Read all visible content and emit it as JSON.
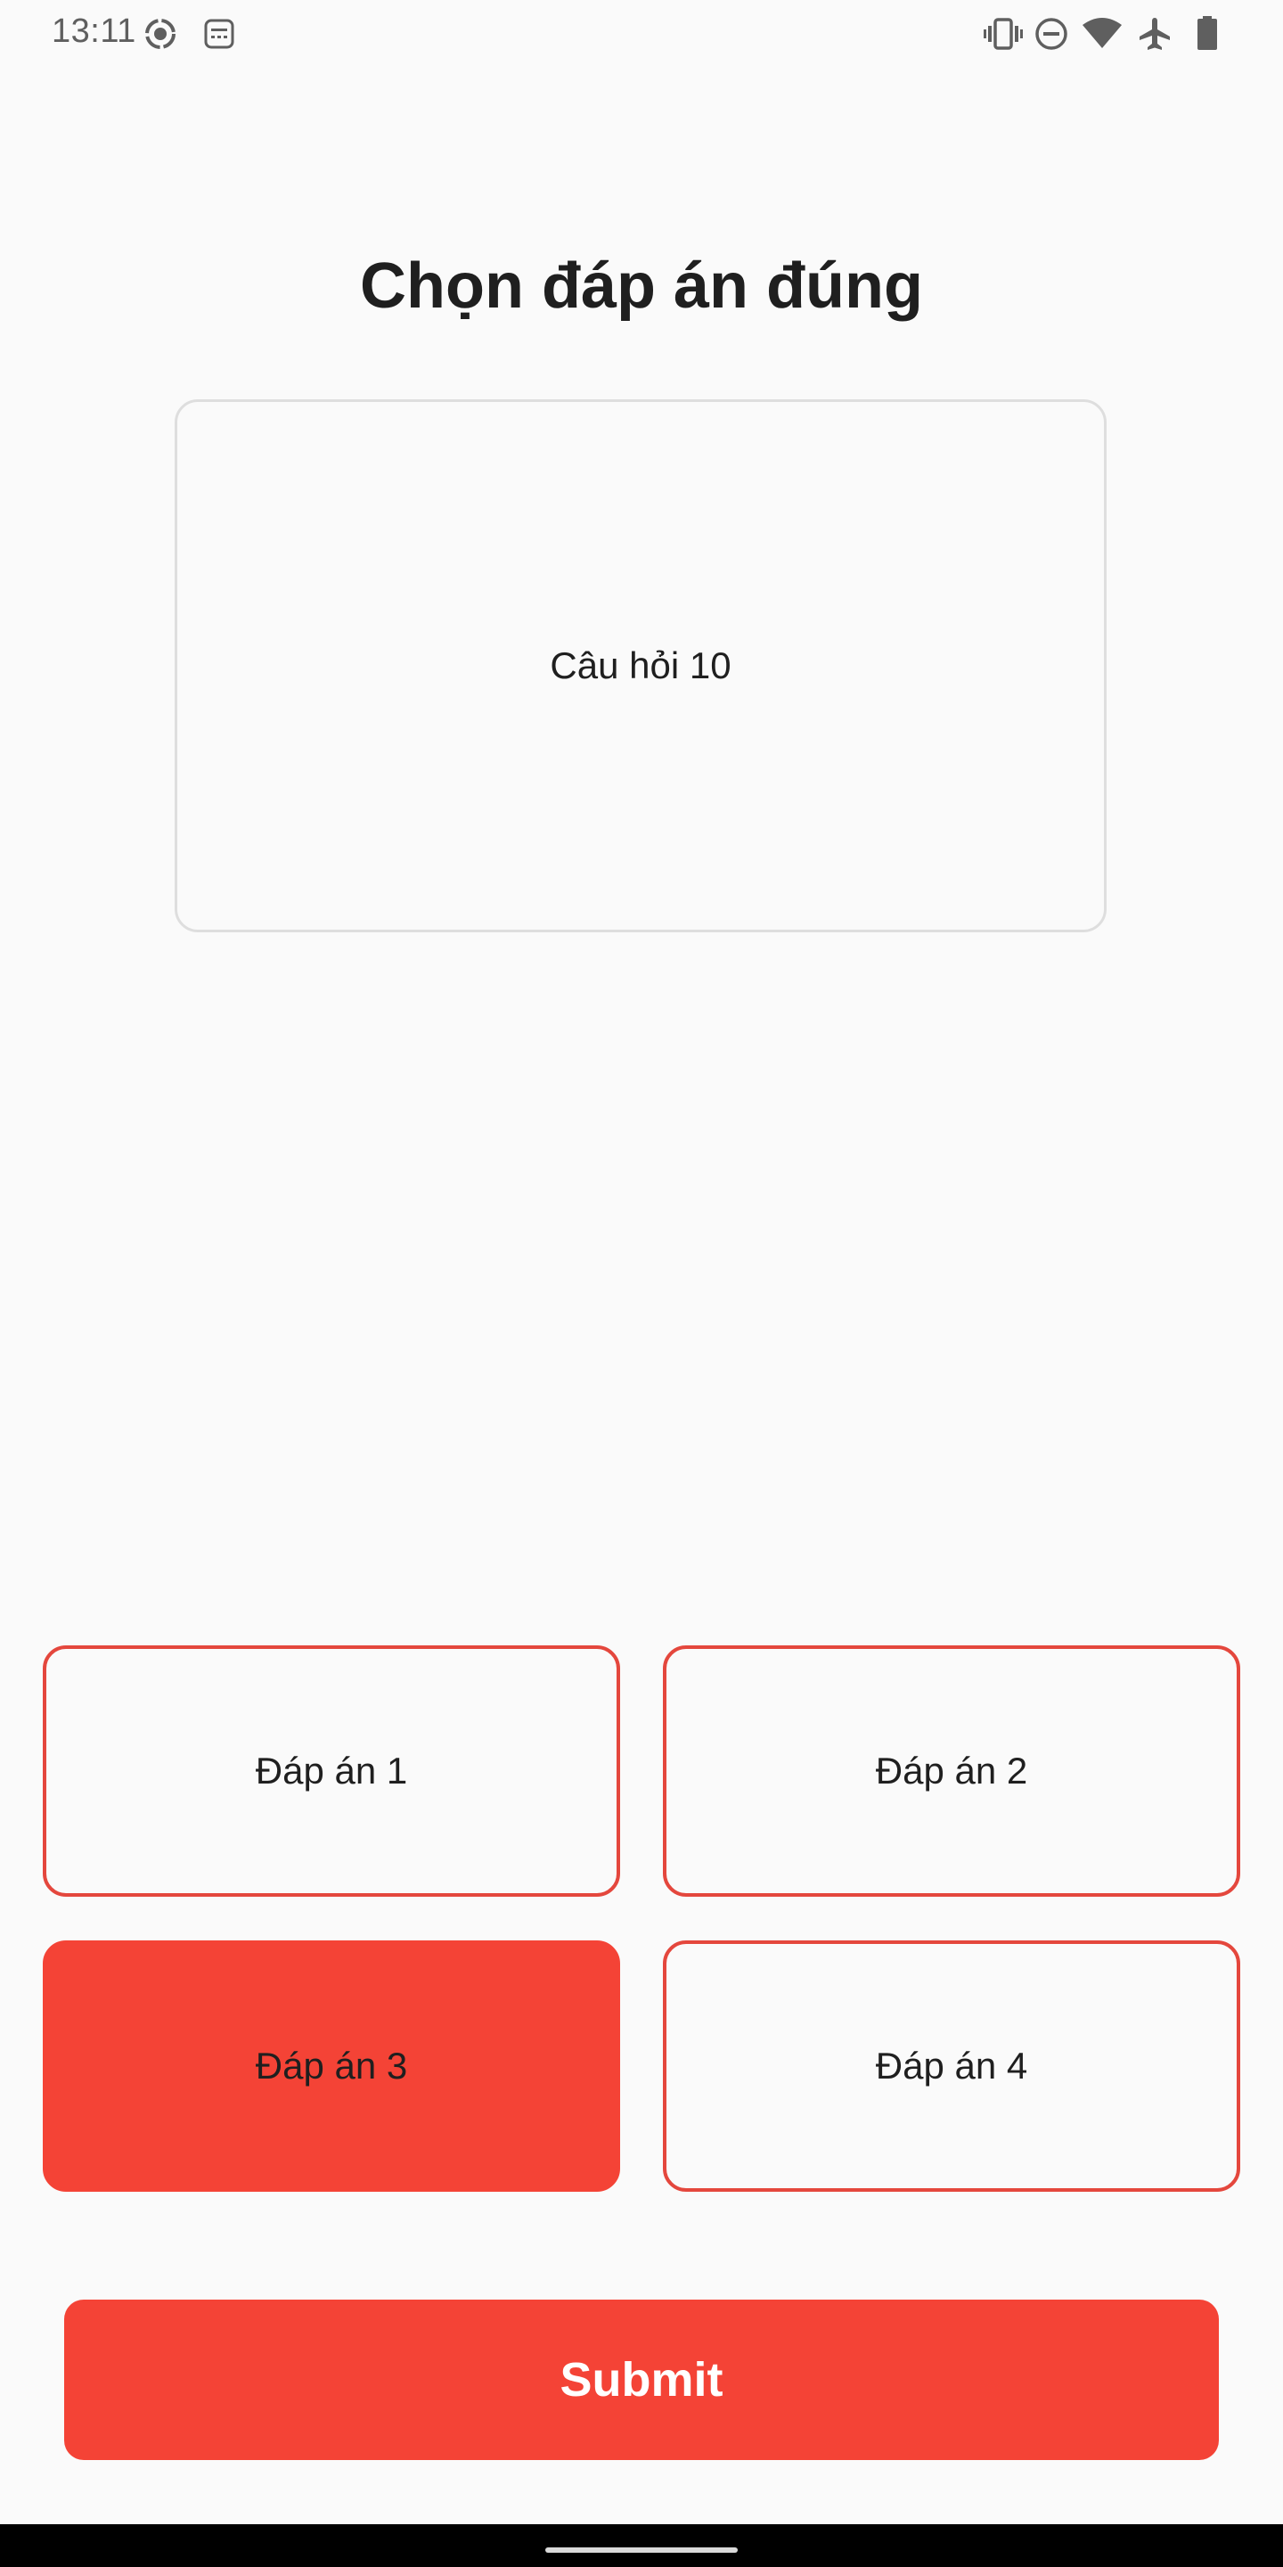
{
  "status_bar": {
    "time": "13:11",
    "icons": [
      "screen-record-icon",
      "keyboard-icon",
      "vibrate-icon",
      "do-not-disturb-icon",
      "wifi-icon",
      "airplane-icon",
      "battery-icon"
    ]
  },
  "page": {
    "title": "Chọn đáp án đúng"
  },
  "question": {
    "text": "Câu hỏi 10"
  },
  "answers": [
    {
      "label": "Đáp án 1",
      "selected": false
    },
    {
      "label": "Đáp án 2",
      "selected": false
    },
    {
      "label": "Đáp án 3",
      "selected": true
    },
    {
      "label": "Đáp án 4",
      "selected": false
    }
  ],
  "submit": {
    "label": "Submit"
  },
  "colors": {
    "accent": "#f44336",
    "answer_border": "#e4473d",
    "background": "#fafafa",
    "card_border": "#dedede"
  }
}
